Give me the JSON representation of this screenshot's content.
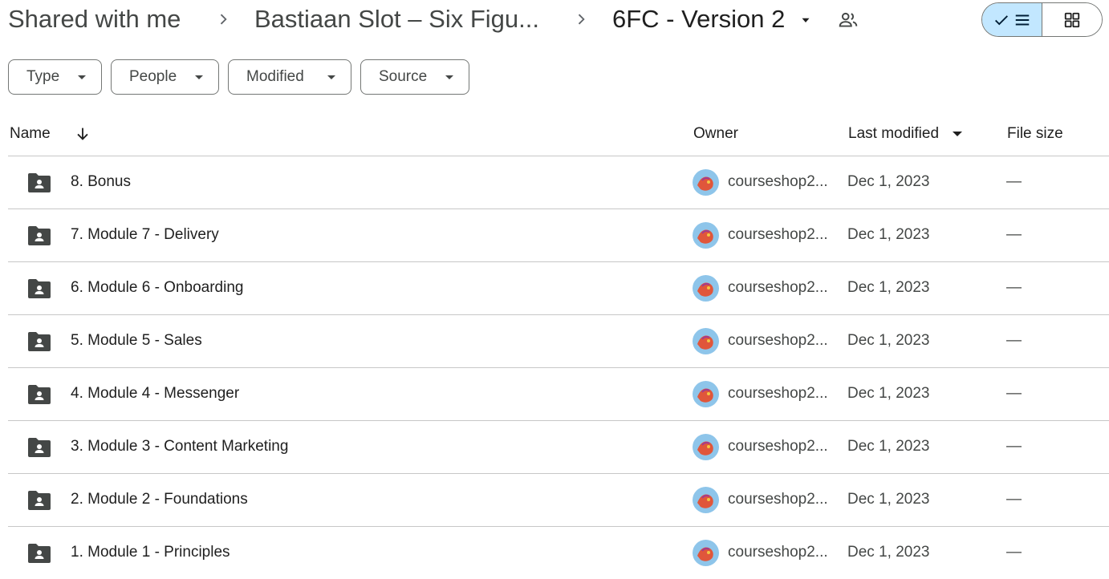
{
  "breadcrumb": {
    "items": [
      "Shared with me",
      "Bastiaan Slot – Six Figu...",
      "6FC - Version 2"
    ]
  },
  "icons": {
    "separator": "chevron-right-icon",
    "dropdown": "caret-down-icon",
    "shared": "people-icon",
    "list_view": "check-list-icon",
    "grid_view": "grid-icon",
    "folder": "shared-folder-icon",
    "sort": "arrow-down-icon"
  },
  "colors": {
    "accent": "#c2e7ff",
    "text": "#1f1f1f",
    "muted": "#444746",
    "divider": "#c7c7c7"
  },
  "filters": [
    {
      "label": "Type"
    },
    {
      "label": "People"
    },
    {
      "label": "Modified"
    },
    {
      "label": "Source"
    }
  ],
  "columns": {
    "name": "Name",
    "owner": "Owner",
    "last_modified": "Last modified",
    "file_size": "File size"
  },
  "rows": [
    {
      "name": "8. Bonus",
      "owner": "courseshop2...",
      "modified": "Dec 1, 2023",
      "size": "—"
    },
    {
      "name": "7. Module 7 - Delivery",
      "owner": "courseshop2...",
      "modified": "Dec 1, 2023",
      "size": "—"
    },
    {
      "name": "6. Module 6 - Onboarding",
      "owner": "courseshop2...",
      "modified": "Dec 1, 2023",
      "size": "—"
    },
    {
      "name": "5. Module 5 - Sales",
      "owner": "courseshop2...",
      "modified": "Dec 1, 2023",
      "size": "—"
    },
    {
      "name": "4. Module 4 - Messenger",
      "owner": "courseshop2...",
      "modified": "Dec 1, 2023",
      "size": "—"
    },
    {
      "name": "3. Module 3 - Content Marketing",
      "owner": "courseshop2...",
      "modified": "Dec 1, 2023",
      "size": "—"
    },
    {
      "name": "2. Module 2 - Foundations",
      "owner": "courseshop2...",
      "modified": "Dec 1, 2023",
      "size": "—"
    },
    {
      "name": "1. Module 1 - Principles",
      "owner": "courseshop2...",
      "modified": "Dec 1, 2023",
      "size": "—"
    }
  ]
}
